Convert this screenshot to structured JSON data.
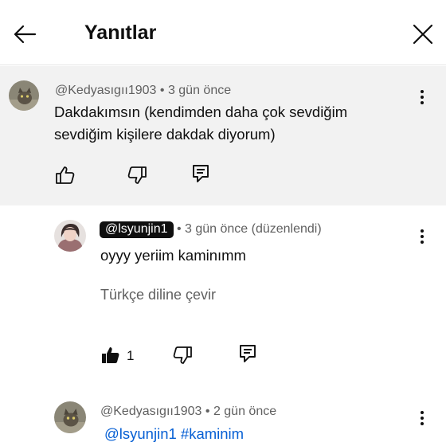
{
  "header": {
    "title": "Yanıtlar",
    "back_icon": "arrow-left-icon",
    "close_icon": "close-icon"
  },
  "comments": [
    {
      "handle": "@Kedyasıgıı1903",
      "time": "• 3 gün önce",
      "text_line1": "Dakdakımsın (kendimden daha çok sevdiğim",
      "text_line2": "sevdiğim kişilere dakdak diyorum)",
      "highlighted": true
    },
    {
      "handle": "@lsyunjin1",
      "time": "• 3 gün önce (düzenlendi)",
      "text": "oyyy yeriim kaminımm",
      "translate": "Türkçe diline çevir",
      "like_count": "1",
      "liked": true
    },
    {
      "handle": "@Kedyasıgıı1903",
      "time": "• 2 gün önce",
      "mention": "@lsyunjin1",
      "hashtag": "#kaminim"
    }
  ],
  "colors": {
    "link": "#065fd4",
    "secondary_text": "#606060",
    "highlight_bg": "#f2f2f2"
  }
}
